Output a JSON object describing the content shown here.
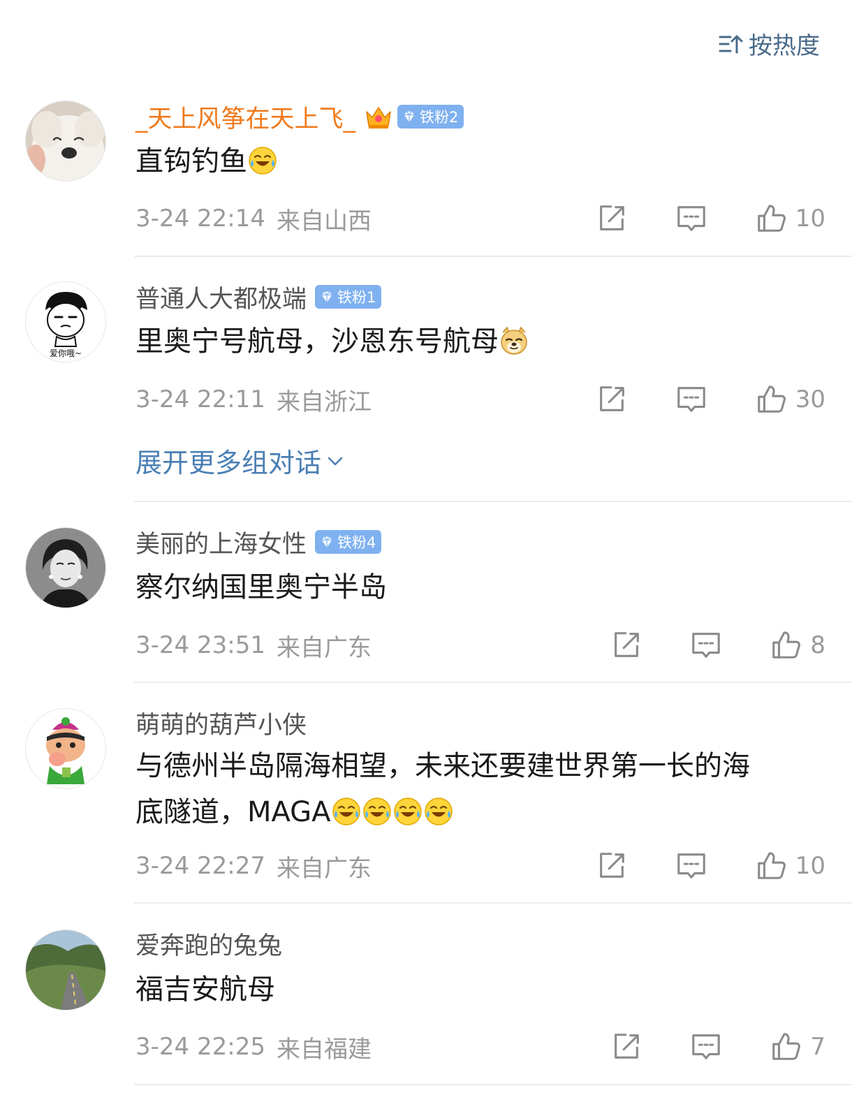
{
  "sort": {
    "label": "按热度",
    "icon": "sort-icon"
  },
  "comments": [
    {
      "username": "_天上风筝在天上飞_",
      "badge": "铁粉2",
      "vip_crown": true,
      "text": "直钩钓鱼",
      "emojis": [
        "laugh-cry"
      ],
      "time": "3-24 22:14",
      "location": "来自山西",
      "likes": "10"
    },
    {
      "username": "普通人大都极端",
      "badge": "铁粉1",
      "avatar_caption": "爱你哦~",
      "text": "里奥宁号航母，沙恩东号航母",
      "emojis": [
        "doge"
      ],
      "time": "3-24 22:11",
      "location": "来自浙江",
      "likes": "30",
      "expand_label": "展开更多组对话"
    },
    {
      "username": "美丽的上海女性",
      "badge": "铁粉4",
      "text": "察尔纳国里奥宁半岛",
      "time": "3-24 23:51",
      "location": "来自广东",
      "likes": "8"
    },
    {
      "username": "萌萌的葫芦小侠",
      "text_line1": "与德州半岛隔海相望，未来还要建世界第一长的海",
      "text_line2": "底隧道，MAGA",
      "emojis": [
        "laugh-cry",
        "laugh-cry",
        "laugh-cry",
        "laugh-cry"
      ],
      "time": "3-24 22:27",
      "location": "来自广东",
      "likes": "10"
    },
    {
      "username": "爱奔跑的兔兔",
      "text": "福吉安航母",
      "time": "3-24 22:25",
      "location": "来自福建",
      "likes": "7"
    }
  ],
  "colors": {
    "accent": "#4a7fb4",
    "orange_name": "#f07a1c",
    "badge": "#7fb1f0",
    "meta": "#9a9a9a"
  }
}
